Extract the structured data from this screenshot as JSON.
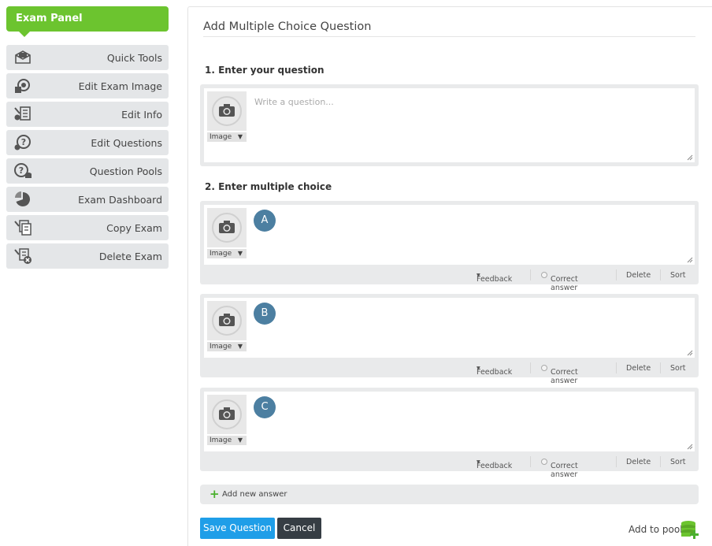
{
  "sidebar": {
    "header": "Exam Panel",
    "items": [
      {
        "label": "Quick Tools",
        "icon": "quick-tools-icon"
      },
      {
        "label": "Edit Exam Image",
        "icon": "exam-image-icon"
      },
      {
        "label": "Edit Info",
        "icon": "edit-info-icon"
      },
      {
        "label": "Edit Questions",
        "icon": "edit-questions-icon"
      },
      {
        "label": "Question Pools",
        "icon": "question-pools-icon"
      },
      {
        "label": "Exam Dashboard",
        "icon": "dashboard-pie-icon"
      },
      {
        "label": "Copy Exam",
        "icon": "copy-exam-icon"
      },
      {
        "label": "Delete Exam",
        "icon": "delete-exam-icon"
      }
    ]
  },
  "main": {
    "title": "Add Multiple Choice Question",
    "step1": "1. Enter your question",
    "question_placeholder": "Write a question...",
    "image_label": "Image",
    "step2": "2. Enter multiple choice",
    "answers": [
      {
        "letter": "A"
      },
      {
        "letter": "B"
      },
      {
        "letter": "C"
      }
    ],
    "footer": {
      "feedback": "Feedback",
      "correct": "Correct answer",
      "delete": "Delete",
      "sort": "Sort"
    },
    "add_new_answer": "Add new answer",
    "save_button": "Save Question",
    "cancel_button": "Cancel",
    "add_to_pool": "Add to pool"
  },
  "colors": {
    "accent_green": "#6cc42f",
    "save_blue": "#1f9ee8",
    "cancel_dark": "#363d44",
    "letter_badge": "#4c7fa1"
  }
}
